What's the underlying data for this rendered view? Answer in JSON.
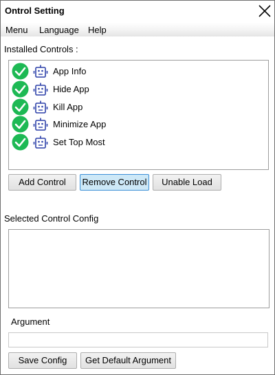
{
  "window": {
    "title": "Ontrol Setting"
  },
  "menu": {
    "items": [
      "Menu",
      "Language",
      "Help"
    ]
  },
  "installed": {
    "label": "Installed Controls :",
    "items": [
      {
        "label": "App Info",
        "checked": true,
        "icon": "robot-icon"
      },
      {
        "label": "Hide App",
        "checked": true,
        "icon": "robot-icon"
      },
      {
        "label": "Kill App",
        "checked": true,
        "icon": "robot-icon"
      },
      {
        "label": "Minimize App",
        "checked": true,
        "icon": "robot-icon"
      },
      {
        "label": "Set Top Most",
        "checked": true,
        "icon": "robot-icon"
      }
    ]
  },
  "buttons": {
    "add": "Add Control",
    "remove": "Remove Control",
    "unable": "Unable Load",
    "save": "Save Config",
    "default_arg": "Get Default Argument"
  },
  "config": {
    "label": "Selected Control Config"
  },
  "argument": {
    "label": "Argument",
    "value": ""
  },
  "colors": {
    "check": "#1db954",
    "robot": "#2b3fa8",
    "button_hover": "#cde8f7",
    "button_hover_border": "#3c8fd6"
  }
}
